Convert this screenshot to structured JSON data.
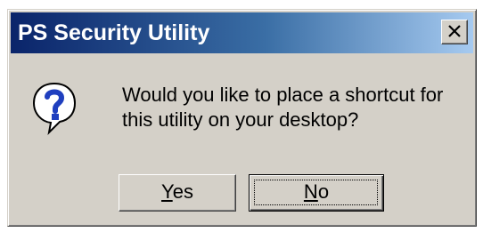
{
  "window": {
    "title": "PS Security Utility",
    "close_icon": "close-x-icon"
  },
  "dialog": {
    "icon": "question-mark-icon",
    "message": "Would you like to place a shortcut for this utility on your desktop?"
  },
  "buttons": {
    "yes": {
      "accel": "Y",
      "rest": "es"
    },
    "no": {
      "accel": "N",
      "rest": "o"
    }
  },
  "colors": {
    "titlebar_start": "#0a246a",
    "titlebar_end": "#a6caf0",
    "face": "#d4d0c8",
    "icon_blue": "#1f3fbf"
  }
}
